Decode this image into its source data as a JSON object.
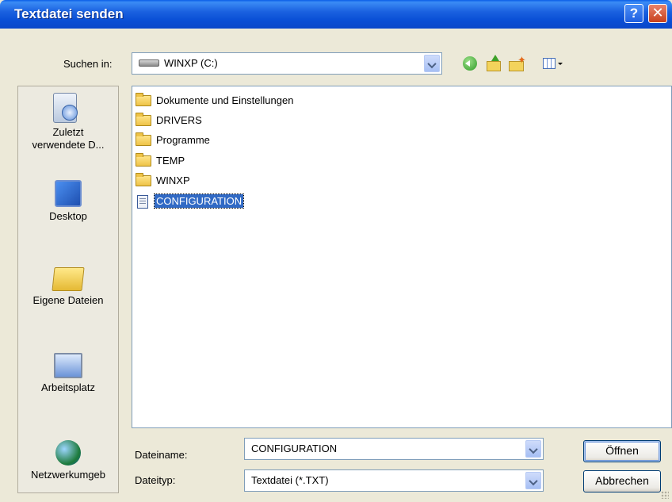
{
  "window": {
    "title": "Textdatei senden",
    "help_glyph": "?",
    "close_glyph": "✕"
  },
  "toolbar": {
    "look_in_label": "Suchen in:",
    "look_in_value": "WINXP (C:)"
  },
  "places": [
    {
      "label": "Zuletzt verwendete D...",
      "icon": "recent-documents-icon"
    },
    {
      "label": "Desktop",
      "icon": "desktop-icon"
    },
    {
      "label": "Eigene Dateien",
      "icon": "my-documents-icon"
    },
    {
      "label": "Arbeitsplatz",
      "icon": "my-computer-icon"
    },
    {
      "label": "Netzwerkumgeb",
      "icon": "network-icon"
    }
  ],
  "files": [
    {
      "name": "Dokumente und Einstellungen",
      "type": "folder"
    },
    {
      "name": "DRIVERS",
      "type": "folder"
    },
    {
      "name": "Programme",
      "type": "folder"
    },
    {
      "name": "TEMP",
      "type": "folder"
    },
    {
      "name": "WINXP",
      "type": "folder"
    },
    {
      "name": "CONFIGURATION",
      "type": "text-file",
      "selected": true
    }
  ],
  "filename": {
    "label": "Dateiname:",
    "value": "CONFIGURATION"
  },
  "filetype": {
    "label": "Dateityp:",
    "value": "Textdatei (*.TXT)"
  },
  "buttons": {
    "open": "Öffnen",
    "cancel": "Abbrechen"
  },
  "colors": {
    "title_bar": "#0a4fd6",
    "selection": "#316ac5",
    "dialog_bg": "#ece9d8"
  }
}
